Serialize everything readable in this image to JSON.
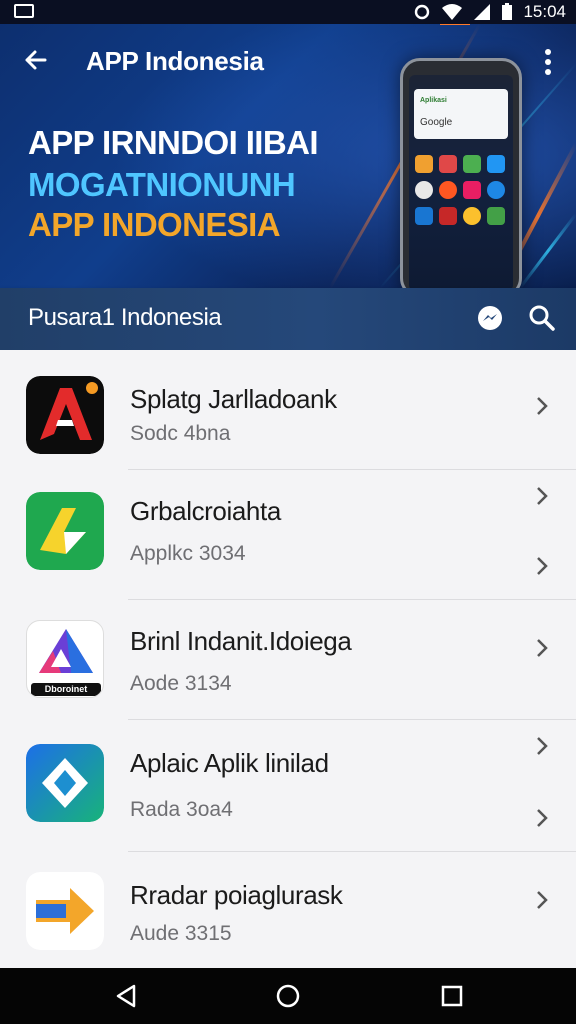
{
  "status_bar": {
    "time": "15:04"
  },
  "banner": {
    "title": "APP Indonesia",
    "headline_lines": [
      "APP IRNNDOI IIBAI",
      "MOGATNIONUNH",
      "APP INDONESIA"
    ],
    "phone_card_top": "Aplikasi",
    "phone_card_search": "Google"
  },
  "title_bar": {
    "text": "Pusara1 Indonesia"
  },
  "apps": [
    {
      "name": "Splatg Jarlladoank",
      "sub": "Sodc 4bna",
      "icon": "red-a-logo-icon"
    },
    {
      "name": "Grbalcroiahta",
      "sub": "Applkc 3034",
      "icon": "green-arrow-logo-icon"
    },
    {
      "name": "Brinl Indanit.Idoiega",
      "sub": "Aode 3134",
      "icon": "purple-triangle-logo-icon",
      "icon_caption": "Dboroinet"
    },
    {
      "name": "Aplaic Aplik linilad",
      "sub": "Rada 3oa4",
      "icon": "blue-diamond-logo-icon"
    },
    {
      "name": "Rradar poiaglurask",
      "sub": "Aude 3315",
      "icon": "orange-arrow-logo-icon"
    }
  ],
  "colors": {
    "banner_bg": "#103e8c",
    "title_bar_bg": "#25487a",
    "headline_blue": "#4fc6ff",
    "headline_orange": "#f3a62a",
    "list_bg": "#f4f4f6"
  }
}
